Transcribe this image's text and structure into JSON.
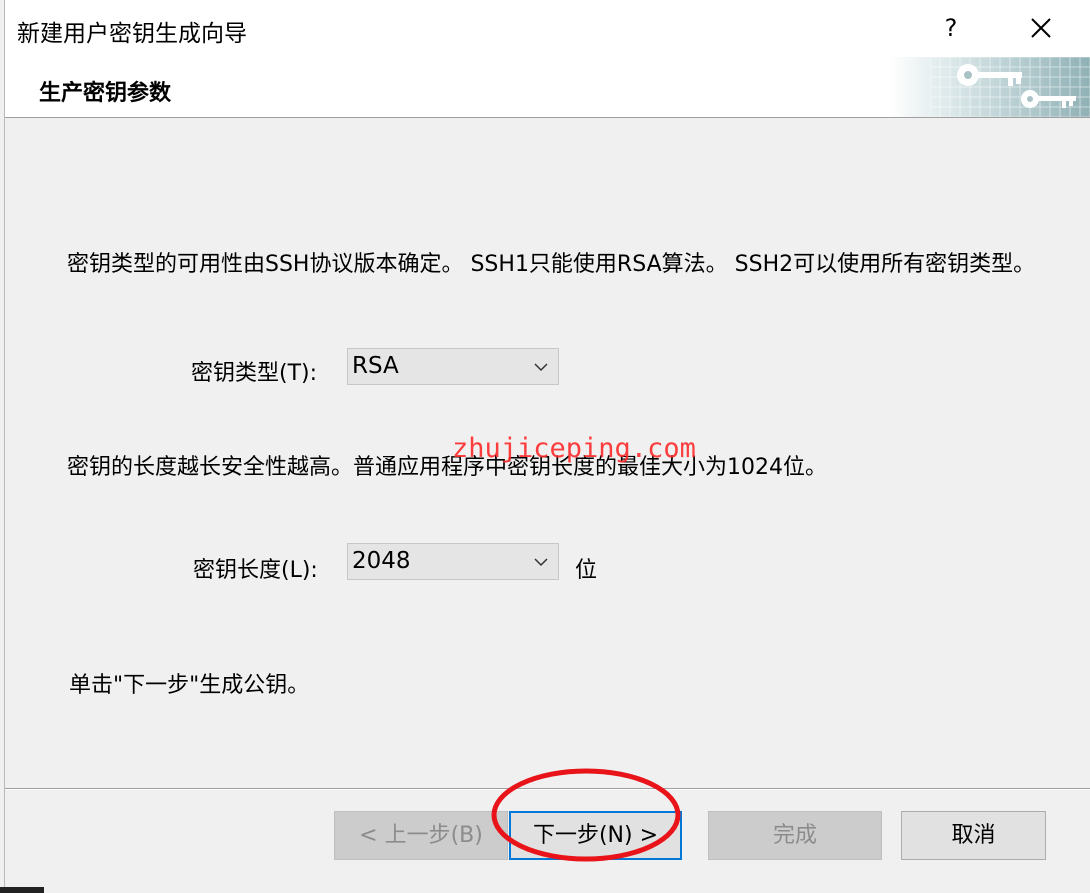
{
  "window": {
    "title": "新建用户密钥生成向导",
    "help_label": "?"
  },
  "header": {
    "title": "生产密钥参数"
  },
  "body": {
    "key_type_description": "密钥类型的可用性由SSH协议版本确定。 SSH1只能使用RSA算法。 SSH2可以使用所有密钥类型。",
    "key_type_label": "密钥类型(T):",
    "key_type_value": "RSA",
    "key_length_description": "密钥的长度越长安全性越高。普通应用程序中密钥长度的最佳大小为1024位。",
    "key_length_label": "密钥长度(L):",
    "key_length_value": "2048",
    "key_length_unit": "位",
    "instruction": "单击\"下一步\"生成公钥。"
  },
  "buttons": {
    "back": "< 上一步(B)",
    "next": "下一步(N) >",
    "finish": "完成",
    "cancel": "取消"
  },
  "watermark": "zhujiceping.com",
  "colors": {
    "dialog_bg": "#f0f0f0",
    "default_button_border": "#0078d7",
    "annotation_circle": "#e8141a"
  }
}
